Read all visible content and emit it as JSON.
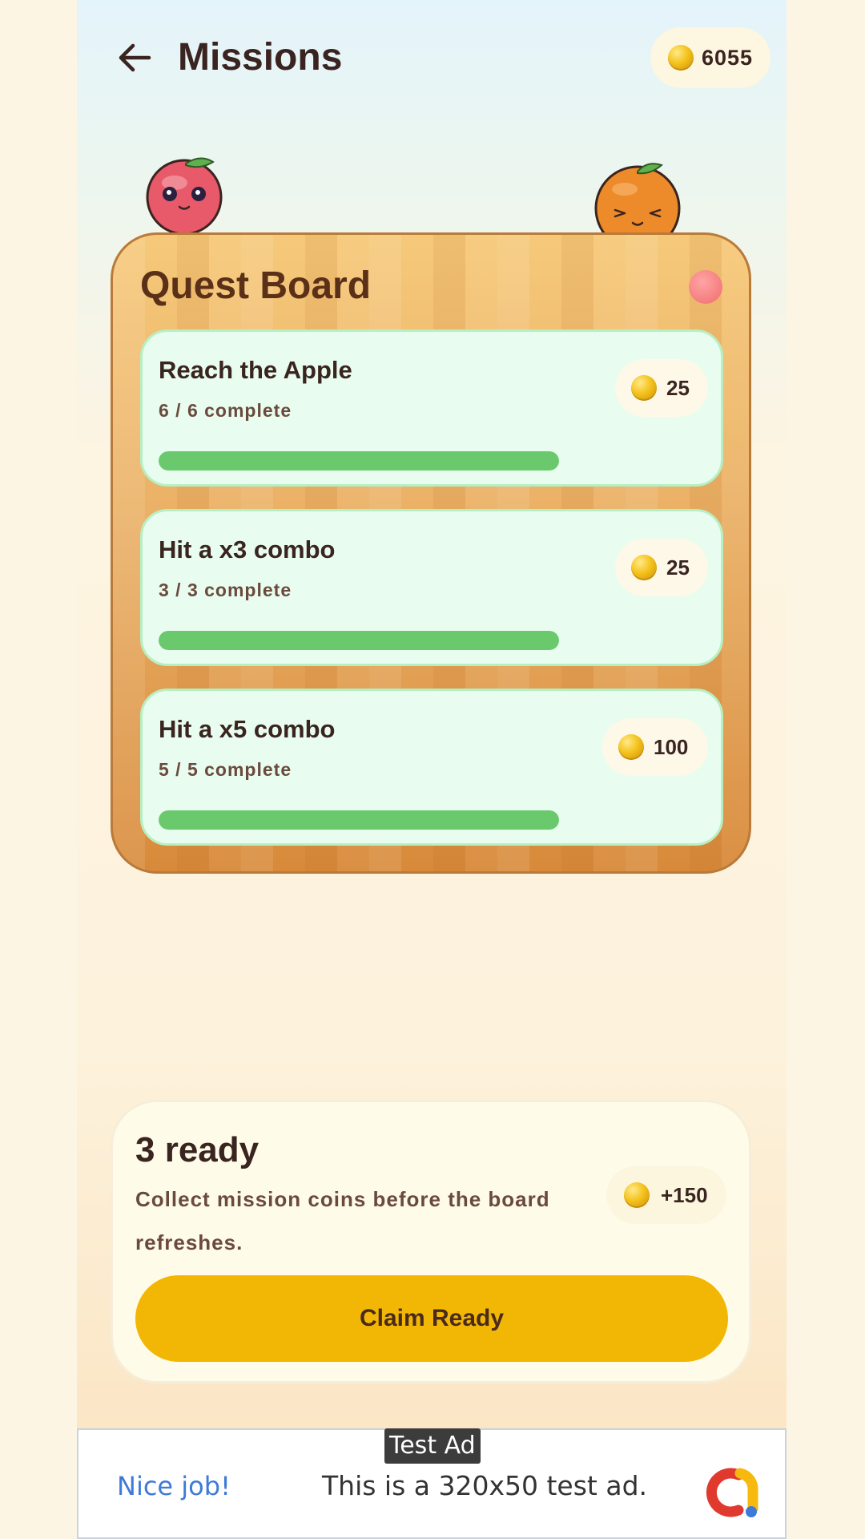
{
  "header": {
    "title": "Missions",
    "coin_balance": "6055"
  },
  "board": {
    "title": "Quest Board",
    "missions": [
      {
        "title": "Reach the Apple",
        "progress_text": "6 / 6 complete",
        "reward": "25",
        "progress": 1.0
      },
      {
        "title": "Hit a x3 combo",
        "progress_text": "3 / 3 complete",
        "reward": "25",
        "progress": 1.0
      },
      {
        "title": "Hit a x5 combo",
        "progress_text": "5 / 5 complete",
        "reward": "100",
        "progress": 1.0
      }
    ]
  },
  "summary": {
    "title": "3 ready",
    "description": "Collect mission coins before the board refreshes.",
    "reward": "+150",
    "claim_label": "Claim Ready"
  },
  "ad": {
    "badge": "Test Ad",
    "left_text": "Nice job!",
    "text": "This is a 320x50 test ad."
  },
  "colors": {
    "accent": "#f2b705",
    "progress": "#6ac96d",
    "card": "#e8fdef",
    "board": "#eab066"
  },
  "icons": {
    "back": "arrow-left-icon",
    "coin": "coin-icon",
    "ad_logo": "admob-logo-icon"
  }
}
